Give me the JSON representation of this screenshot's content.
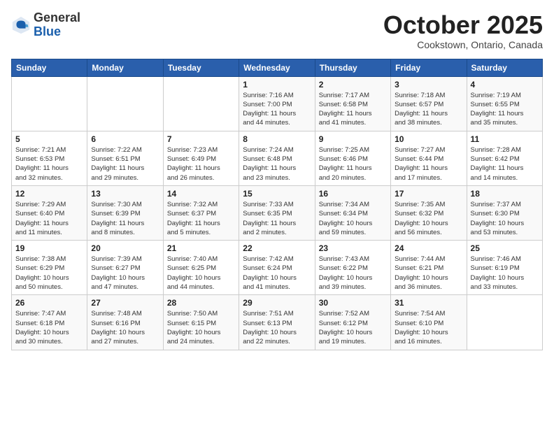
{
  "header": {
    "logo_general": "General",
    "logo_blue": "Blue",
    "month_title": "October 2025",
    "location": "Cookstown, Ontario, Canada"
  },
  "days_of_week": [
    "Sunday",
    "Monday",
    "Tuesday",
    "Wednesday",
    "Thursday",
    "Friday",
    "Saturday"
  ],
  "weeks": [
    [
      {
        "day": "",
        "info": ""
      },
      {
        "day": "",
        "info": ""
      },
      {
        "day": "",
        "info": ""
      },
      {
        "day": "1",
        "info": "Sunrise: 7:16 AM\nSunset: 7:00 PM\nDaylight: 11 hours\nand 44 minutes."
      },
      {
        "day": "2",
        "info": "Sunrise: 7:17 AM\nSunset: 6:58 PM\nDaylight: 11 hours\nand 41 minutes."
      },
      {
        "day": "3",
        "info": "Sunrise: 7:18 AM\nSunset: 6:57 PM\nDaylight: 11 hours\nand 38 minutes."
      },
      {
        "day": "4",
        "info": "Sunrise: 7:19 AM\nSunset: 6:55 PM\nDaylight: 11 hours\nand 35 minutes."
      }
    ],
    [
      {
        "day": "5",
        "info": "Sunrise: 7:21 AM\nSunset: 6:53 PM\nDaylight: 11 hours\nand 32 minutes."
      },
      {
        "day": "6",
        "info": "Sunrise: 7:22 AM\nSunset: 6:51 PM\nDaylight: 11 hours\nand 29 minutes."
      },
      {
        "day": "7",
        "info": "Sunrise: 7:23 AM\nSunset: 6:49 PM\nDaylight: 11 hours\nand 26 minutes."
      },
      {
        "day": "8",
        "info": "Sunrise: 7:24 AM\nSunset: 6:48 PM\nDaylight: 11 hours\nand 23 minutes."
      },
      {
        "day": "9",
        "info": "Sunrise: 7:25 AM\nSunset: 6:46 PM\nDaylight: 11 hours\nand 20 minutes."
      },
      {
        "day": "10",
        "info": "Sunrise: 7:27 AM\nSunset: 6:44 PM\nDaylight: 11 hours\nand 17 minutes."
      },
      {
        "day": "11",
        "info": "Sunrise: 7:28 AM\nSunset: 6:42 PM\nDaylight: 11 hours\nand 14 minutes."
      }
    ],
    [
      {
        "day": "12",
        "info": "Sunrise: 7:29 AM\nSunset: 6:40 PM\nDaylight: 11 hours\nand 11 minutes."
      },
      {
        "day": "13",
        "info": "Sunrise: 7:30 AM\nSunset: 6:39 PM\nDaylight: 11 hours\nand 8 minutes."
      },
      {
        "day": "14",
        "info": "Sunrise: 7:32 AM\nSunset: 6:37 PM\nDaylight: 11 hours\nand 5 minutes."
      },
      {
        "day": "15",
        "info": "Sunrise: 7:33 AM\nSunset: 6:35 PM\nDaylight: 11 hours\nand 2 minutes."
      },
      {
        "day": "16",
        "info": "Sunrise: 7:34 AM\nSunset: 6:34 PM\nDaylight: 10 hours\nand 59 minutes."
      },
      {
        "day": "17",
        "info": "Sunrise: 7:35 AM\nSunset: 6:32 PM\nDaylight: 10 hours\nand 56 minutes."
      },
      {
        "day": "18",
        "info": "Sunrise: 7:37 AM\nSunset: 6:30 PM\nDaylight: 10 hours\nand 53 minutes."
      }
    ],
    [
      {
        "day": "19",
        "info": "Sunrise: 7:38 AM\nSunset: 6:29 PM\nDaylight: 10 hours\nand 50 minutes."
      },
      {
        "day": "20",
        "info": "Sunrise: 7:39 AM\nSunset: 6:27 PM\nDaylight: 10 hours\nand 47 minutes."
      },
      {
        "day": "21",
        "info": "Sunrise: 7:40 AM\nSunset: 6:25 PM\nDaylight: 10 hours\nand 44 minutes."
      },
      {
        "day": "22",
        "info": "Sunrise: 7:42 AM\nSunset: 6:24 PM\nDaylight: 10 hours\nand 41 minutes."
      },
      {
        "day": "23",
        "info": "Sunrise: 7:43 AM\nSunset: 6:22 PM\nDaylight: 10 hours\nand 39 minutes."
      },
      {
        "day": "24",
        "info": "Sunrise: 7:44 AM\nSunset: 6:21 PM\nDaylight: 10 hours\nand 36 minutes."
      },
      {
        "day": "25",
        "info": "Sunrise: 7:46 AM\nSunset: 6:19 PM\nDaylight: 10 hours\nand 33 minutes."
      }
    ],
    [
      {
        "day": "26",
        "info": "Sunrise: 7:47 AM\nSunset: 6:18 PM\nDaylight: 10 hours\nand 30 minutes."
      },
      {
        "day": "27",
        "info": "Sunrise: 7:48 AM\nSunset: 6:16 PM\nDaylight: 10 hours\nand 27 minutes."
      },
      {
        "day": "28",
        "info": "Sunrise: 7:50 AM\nSunset: 6:15 PM\nDaylight: 10 hours\nand 24 minutes."
      },
      {
        "day": "29",
        "info": "Sunrise: 7:51 AM\nSunset: 6:13 PM\nDaylight: 10 hours\nand 22 minutes."
      },
      {
        "day": "30",
        "info": "Sunrise: 7:52 AM\nSunset: 6:12 PM\nDaylight: 10 hours\nand 19 minutes."
      },
      {
        "day": "31",
        "info": "Sunrise: 7:54 AM\nSunset: 6:10 PM\nDaylight: 10 hours\nand 16 minutes."
      },
      {
        "day": "",
        "info": ""
      }
    ]
  ]
}
